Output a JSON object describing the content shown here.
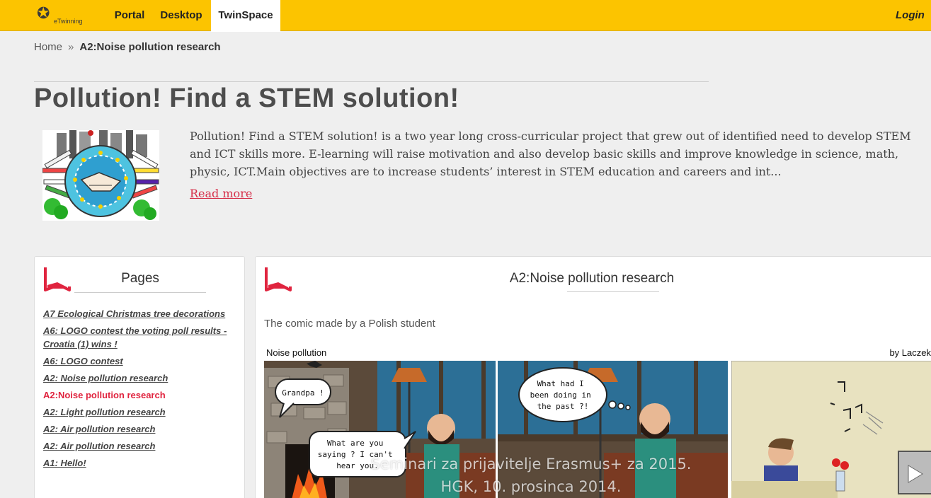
{
  "nav": {
    "logo_text": "eTwinning",
    "items": [
      {
        "label": "Portal"
      },
      {
        "label": "Desktop"
      },
      {
        "label": "TwinSpace"
      }
    ],
    "login_label": "Login"
  },
  "breadcrumb": {
    "home": "Home",
    "separator": "»",
    "current": "A2:Noise pollution research"
  },
  "project": {
    "title": "Pollution! Find a STEM solution!",
    "description": "Pollution! Find a STEM solution! is a two year long cross-curricular project that grew out of identified need to develop STEM and ICT skills more. E-learning will raise motivation and also develop basic skills and improve knowledge in science, math, physic, ICT.Main objectives are to increase students’ interest in STEM education and careers and int...",
    "read_more": "Read more"
  },
  "sidebar": {
    "title": "Pages",
    "items": [
      {
        "label": "A7 Ecological Christmas tree decorations"
      },
      {
        "label": "A6: LOGO contest the voting poll results - Croatia (1) wins !"
      },
      {
        "label": "A6: LOGO contest"
      },
      {
        "label": "A2: Noise pollution research"
      },
      {
        "label": "A2:Noise pollution research"
      },
      {
        "label": "A2: Light pollution research"
      },
      {
        "label": "A2: Air pollution research"
      },
      {
        "label": "A2: Air pollution research"
      },
      {
        "label": "A1: Hello!"
      }
    ]
  },
  "main": {
    "title": "A2:Noise pollution research",
    "caption": "The comic made by a Polish student",
    "comic": {
      "name": "Noise pollution",
      "author": "by Laczek",
      "bubble1": "Grandpa !",
      "bubble2_lines": [
        "What are you",
        "saying ? I can't",
        "hear you."
      ],
      "bubble3_lines": [
        "What had I",
        "been doing in",
        "the past ?!"
      ]
    }
  },
  "watermark": {
    "line1": "Seminari za prijavitelje Erasmus+ za 2015.",
    "line2": "HGK, 10. prosinca 2014."
  },
  "colors": {
    "topbar": "#fcc400",
    "accent": "#e0243f"
  }
}
